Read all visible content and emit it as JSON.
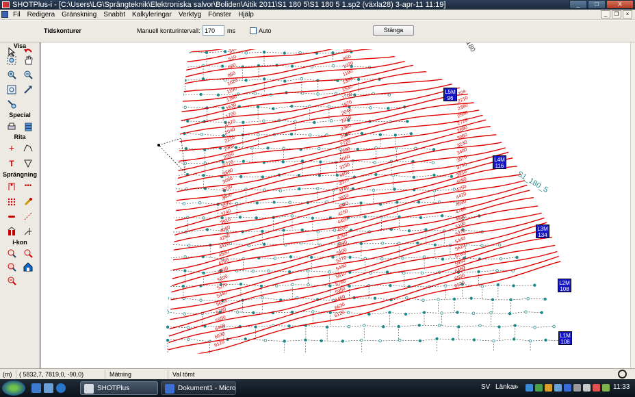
{
  "window": {
    "title": "SHOTPlus-i - [C:\\Users\\LG\\Sprängteknik\\Elektroniska salvor\\Boliden\\Aitik 2011\\S1 180 5\\S1 180 5 1.sp2 (växla28) 3-apr-11 11:19]",
    "minimize": "_",
    "maximize": "□",
    "close": "X"
  },
  "menu": {
    "items": [
      "Fil",
      "Redigera",
      "Gränskning",
      "Snabbt",
      "Kalkyleringar",
      "Verktyg",
      "Fönster",
      "Hjälp"
    ],
    "mdi_min": "_",
    "mdi_restore": "❐",
    "mdi_close": "×"
  },
  "toolbar": {
    "section_label": "Tidskonturer",
    "interval_label": "Manuell konturintervall:",
    "interval_value": "170",
    "interval_unit": "ms",
    "auto_label": "Auto",
    "close_button": "Stänga"
  },
  "palette": {
    "sections": {
      "view": "Visa",
      "special": "Special",
      "draw": "Rita",
      "blasting": "Sprängning",
      "icon": "i-kon"
    },
    "icons": {
      "select": "arrow-select-icon",
      "undo": "undo-icon",
      "zoom_window": "zoom-window-icon",
      "pan": "hand-pan-icon",
      "zoom_in": "zoom-in-icon",
      "zoom_out": "zoom-out-icon",
      "zoom_extents": "zoom-extents-icon",
      "rotate": "rotate-view-icon",
      "special_a": "special-tool-icon",
      "print": "print-icon",
      "layers": "layers-icon",
      "draw_point": "draw-point-icon",
      "draw_line": "draw-polyline-icon",
      "draw_text": "draw-text-icon",
      "draw_shape": "draw-triangle-icon",
      "hole": "hole-icon",
      "hole_row": "hole-row-icon",
      "pattern": "hole-pattern-icon",
      "detonator": "detonator-icon",
      "connector": "surface-connector-icon",
      "delay_line": "delay-line-icon",
      "charge": "charge-icon",
      "initiate": "initiate-icon",
      "ikon_a": "ikon-a-icon",
      "ikon_b": "ikon-b-icon",
      "ikon_c": "ikon-c-icon",
      "ikon_d": "ikon-d-icon",
      "ikon_e": "ikon-e-icon"
    }
  },
  "canvas": {
    "contour_color": "#e00000",
    "hole_color": "#1a8a8a",
    "connector_color": "#333333",
    "contour_labels": [
      "6120",
      "6630",
      "6460",
      "5950",
      "5780",
      "5610",
      "5440",
      "5270",
      "5100",
      "4930",
      "4760",
      "4590",
      "4420",
      "4250",
      "4080",
      "3910",
      "3740",
      "3570",
      "3400",
      "3230",
      "3060",
      "2890",
      "2720",
      "2550",
      "2380",
      "2210",
      "2040",
      "1870",
      "1700",
      "1530",
      "1360",
      "1190",
      "1020",
      "850",
      "680",
      "510",
      "340",
      "170"
    ],
    "line_tag": "S1_180_5",
    "line_tag_top": "180",
    "markers": [
      {
        "id": "L5M",
        "value": "96"
      },
      {
        "id": "L4M",
        "value": "116"
      },
      {
        "id": "L3M",
        "value": "134"
      },
      {
        "id": "L2M",
        "value": "108"
      },
      {
        "id": "L1M",
        "value": "108"
      }
    ]
  },
  "status": {
    "units": "(m)",
    "coords": "(    5832,7,     7819,0,     -90,0)",
    "mode": "Mätning",
    "selection": "Val tömt"
  },
  "taskbar": {
    "tasks": [
      {
        "label": "SHOTPlus"
      },
      {
        "label": "Dokument1 - Micro..."
      }
    ],
    "lang": "SV",
    "links": "Länkar",
    "links_chevron": "»",
    "clock": "11:33"
  }
}
